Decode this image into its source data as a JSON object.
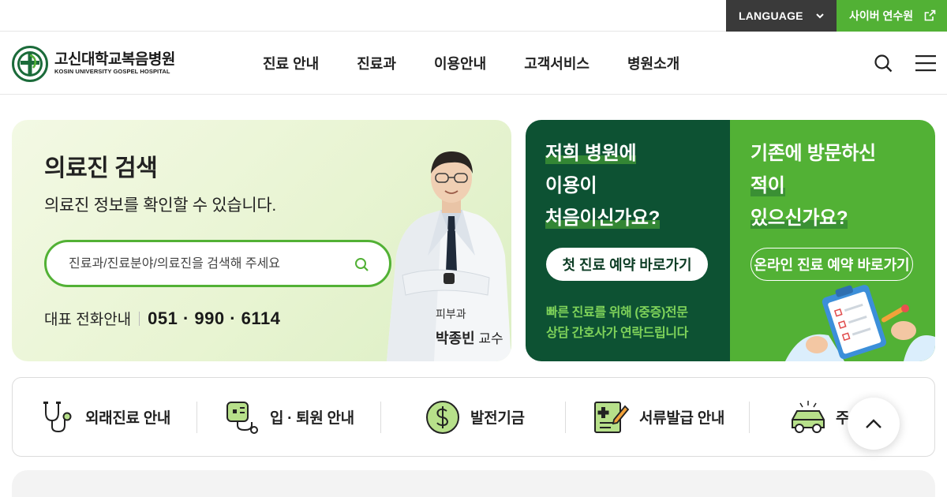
{
  "topbar": {
    "language_label": "LANGUAGE",
    "cyber_label": "사이버 연수원"
  },
  "header": {
    "logo_ko": "고신대학교복음병원",
    "logo_en": "KOSIN UNIVERSITY GOSPEL HOSPITAL",
    "nav": [
      "진료 안내",
      "진료과",
      "이용안내",
      "고객서비스",
      "병원소개"
    ],
    "search_icon": "search-icon",
    "menu_icon": "hamburger-menu-icon"
  },
  "doctor_search": {
    "title": "의료진 검색",
    "subtitle": "의료진 정보를 확인할 수 있습니다.",
    "placeholder": "진료과/진료분야/의료진을 검색해 주세요",
    "phone_label": "대표 전화안내",
    "phone_number": "051 · 990 · 6114",
    "doctor_dept": "피부과",
    "doctor_name": "박종빈",
    "doctor_title": "교수"
  },
  "first_visit": {
    "line1": "저희 병원에",
    "line2": "이용이",
    "line3": "처음이신가요?",
    "button": "첫 진료 예약 바로가기",
    "note1": "빠른 진료를 위해 (중증)전문",
    "note2": "상담 간호사가 연락드립니다"
  },
  "return_visit": {
    "line1": "기존에 방문하신",
    "line2": "적이",
    "line3": "있으신가요?",
    "button": "온라인 진료 예약 바로가기"
  },
  "quick_links": [
    {
      "label": "외래진료 안내",
      "icon": "stethoscope-icon"
    },
    {
      "label": "입 · 퇴원 안내",
      "icon": "iv-bag-icon"
    },
    {
      "label": "발전기금",
      "icon": "dollar-coin-icon"
    },
    {
      "label": "서류발급 안내",
      "icon": "document-pen-icon"
    },
    {
      "label": "주",
      "icon": "car-icon"
    }
  ],
  "colors": {
    "brand_green": "#52b135",
    "dark_green": "#0d5233",
    "topbar_dark": "#3a3a3a"
  }
}
